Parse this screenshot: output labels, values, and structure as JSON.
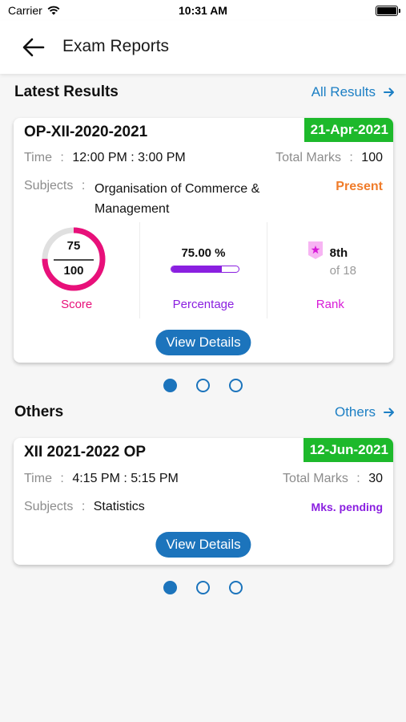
{
  "status_bar": {
    "carrier": "Carrier",
    "time": "10:31 AM"
  },
  "header": {
    "title": "Exam Reports"
  },
  "latest": {
    "section_title": "Latest Results",
    "link_label": "All Results",
    "card": {
      "code": "OP-XII-2020-2021",
      "date": "21-Apr-2021",
      "time_label": "Time",
      "time_value": "12:00 PM : 3:00 PM",
      "total_marks_label": "Total Marks",
      "total_marks_value": "100",
      "subjects_label": "Subjects",
      "subjects_line1": "Organisation of Commerce &",
      "subjects_line2": "Management",
      "attendance": "Present",
      "score": {
        "obtained": "75",
        "total": "100",
        "caption": "Score",
        "fraction": 0.75
      },
      "percentage": {
        "value": "75.00 %",
        "caption": "Percentage",
        "fraction": 0.75
      },
      "rank": {
        "position": "8th",
        "of": "of 18",
        "caption": "Rank"
      },
      "button_label": "View Details"
    },
    "pager": {
      "count": 3,
      "active": 0
    }
  },
  "others": {
    "section_title": "Others",
    "link_label": "Others",
    "card": {
      "code": "XII 2021-2022 OP",
      "date": "12-Jun-2021",
      "time_label": "Time",
      "time_value": "4:15 PM : 5:15 PM",
      "total_marks_label": "Total Marks",
      "total_marks_value": "30",
      "subjects_label": "Subjects",
      "subjects_value": "Statistics",
      "status": "Mks. pending",
      "button_label": "View Details"
    },
    "pager": {
      "count": 3,
      "active": 0
    }
  },
  "colors": {
    "accent_blue": "#1c74bc",
    "date_green": "#1db92b",
    "score_pink": "#e8107a",
    "percentage_purple": "#8a1fe0",
    "rank_magenta": "#d81bd8",
    "present_orange": "#f07c2a"
  },
  "icons": [
    "wifi-icon",
    "battery-icon",
    "back-arrow-icon",
    "arrow-right-icon",
    "rank-badge-icon"
  ]
}
